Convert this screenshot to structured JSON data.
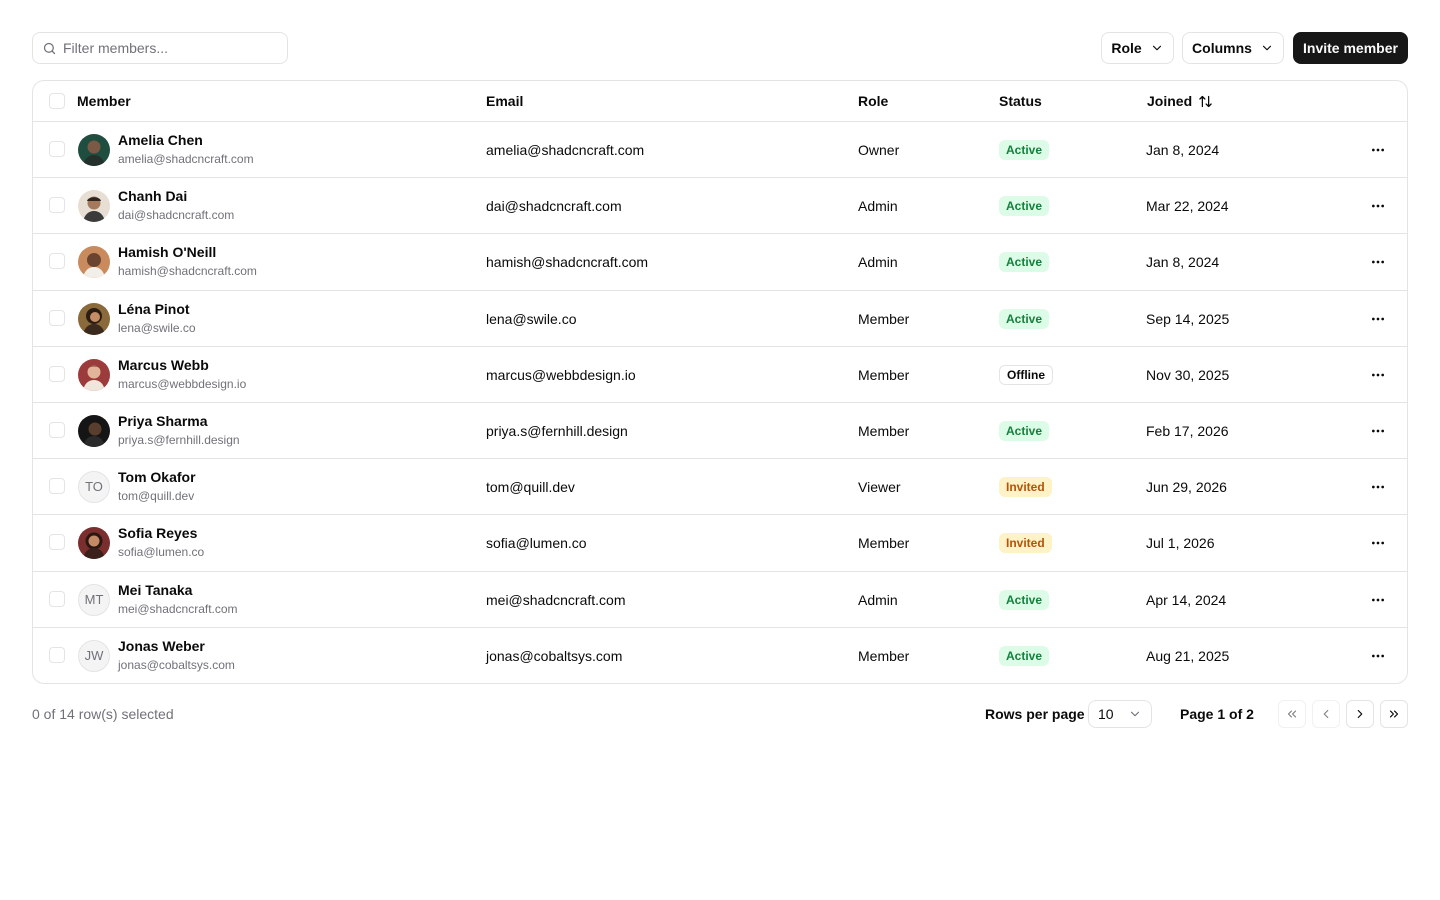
{
  "toolbar": {
    "search_placeholder": "Filter members...",
    "role_label": "Role",
    "columns_label": "Columns",
    "invite_label": "Invite member"
  },
  "table": {
    "headers": {
      "member": "Member",
      "email": "Email",
      "role": "Role",
      "status": "Status",
      "joined": "Joined"
    },
    "rows": [
      {
        "name": "Amelia Chen",
        "sub": "amelia@shadcncraft.com",
        "email": "amelia@shadcncraft.com",
        "role": "Owner",
        "status": "Active",
        "joined": "Jan 8, 2024"
      },
      {
        "name": "Chanh Dai",
        "sub": "dai@shadcncraft.com",
        "email": "dai@shadcncraft.com",
        "role": "Admin",
        "status": "Active",
        "joined": "Mar 22, 2024"
      },
      {
        "name": "Hamish O'Neill",
        "sub": "hamish@shadcncraft.com",
        "email": "hamish@shadcncraft.com",
        "role": "Admin",
        "status": "Active",
        "joined": "Jan 8, 2024"
      },
      {
        "name": "Léna Pinot",
        "sub": "lena@swile.co",
        "email": "lena@swile.co",
        "role": "Member",
        "status": "Active",
        "joined": "Sep 14, 2025"
      },
      {
        "name": "Marcus Webb",
        "sub": "marcus@webbdesign.io",
        "email": "marcus@webbdesign.io",
        "role": "Member",
        "status": "Offline",
        "joined": "Nov 30, 2025"
      },
      {
        "name": "Priya Sharma",
        "sub": "priya.s@fernhill.design",
        "email": "priya.s@fernhill.design",
        "role": "Member",
        "status": "Active",
        "joined": "Feb 17, 2026"
      },
      {
        "name": "Tom Okafor",
        "sub": "tom@quill.dev",
        "email": "tom@quill.dev",
        "role": "Viewer",
        "status": "Invited",
        "joined": "Jun 29, 2026",
        "initials": "TO"
      },
      {
        "name": "Sofia Reyes",
        "sub": "sofia@lumen.co",
        "email": "sofia@lumen.co",
        "role": "Member",
        "status": "Invited",
        "joined": "Jul 1, 2026"
      },
      {
        "name": "Mei Tanaka",
        "sub": "mei@shadcncraft.com",
        "email": "mei@shadcncraft.com",
        "role": "Admin",
        "status": "Active",
        "joined": "Apr 14, 2024",
        "initials": "MT"
      },
      {
        "name": "Jonas Weber",
        "sub": "jonas@cobaltsys.com",
        "email": "jonas@cobaltsys.com",
        "role": "Member",
        "status": "Active",
        "joined": "Aug 21, 2025",
        "initials": "JW"
      }
    ]
  },
  "footer": {
    "selection": "0 of 14 row(s) selected",
    "rows_per_page_label": "Rows per page",
    "rows_per_page_value": "10",
    "page_info": "Page 1 of 2"
  },
  "colors": {
    "primary": "#171717",
    "border": "#e4e4e7",
    "muted_text": "#71717a",
    "active_bg": "#dcfce7",
    "active_text": "#15803d",
    "invited_bg": "#fef3c7",
    "invited_text": "#b45309"
  },
  "icons": {
    "search": "search-icon",
    "chevron": "chevron-down-icon",
    "sort": "sort-arrows-icon",
    "more": "more-horizontal-icon",
    "first": "chevrons-left-icon",
    "prev": "chevron-left-icon",
    "next": "chevron-right-icon",
    "last": "chevrons-right-icon"
  }
}
